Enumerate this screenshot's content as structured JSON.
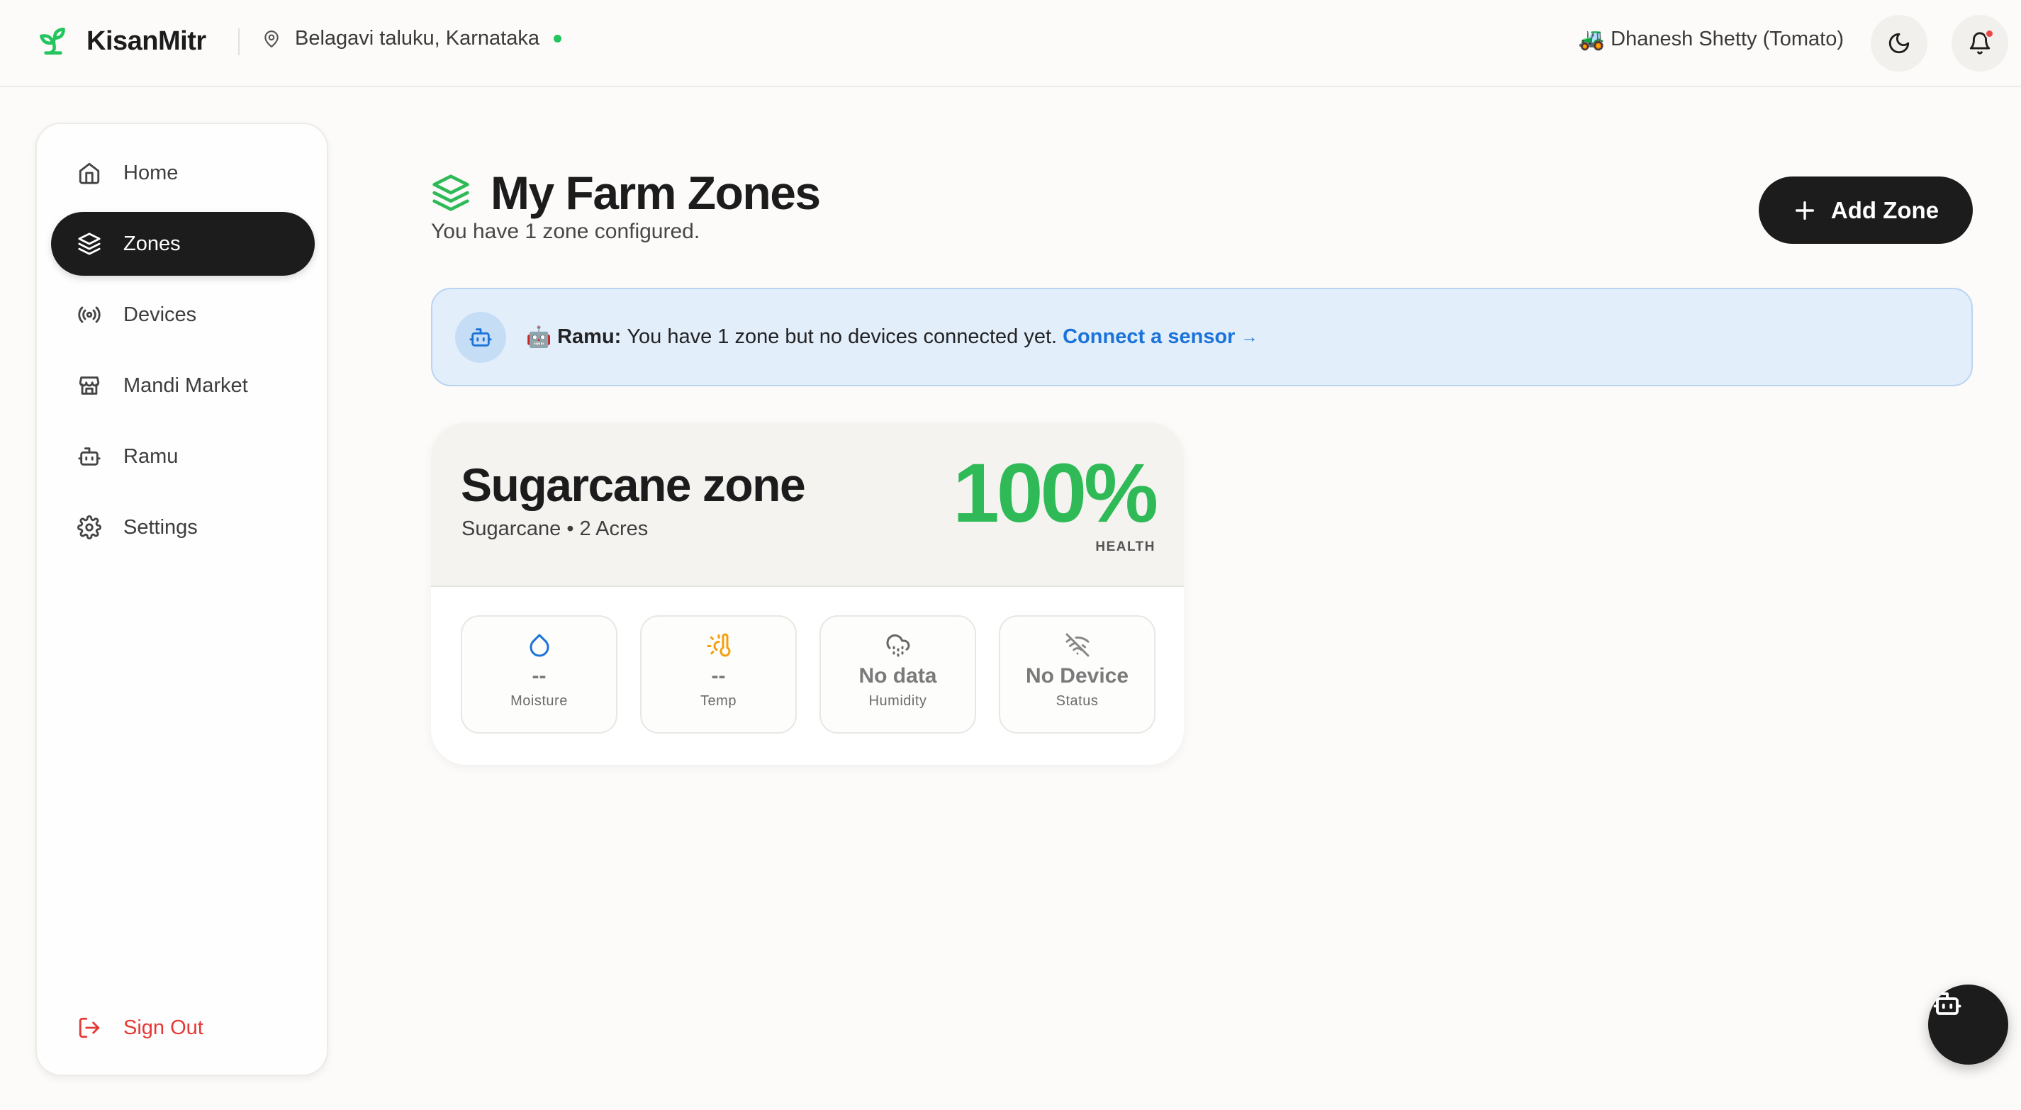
{
  "header": {
    "brand": "KisanMitr",
    "location": "Belagavi taluku, Karnataka",
    "user_emoji": "🚜",
    "user": "Dhanesh Shetty (Tomato)",
    "accent": "#22c55e"
  },
  "sidebar": {
    "items": [
      {
        "label": "Home",
        "icon": "home-icon"
      },
      {
        "label": "Zones",
        "icon": "layers-icon",
        "active": true
      },
      {
        "label": "Devices",
        "icon": "broadcast-icon"
      },
      {
        "label": "Mandi Market",
        "icon": "store-icon"
      },
      {
        "label": "Ramu",
        "icon": "bot-icon"
      },
      {
        "label": "Settings",
        "icon": "gear-icon"
      }
    ],
    "sign_out": "Sign Out"
  },
  "main": {
    "title": "My Farm Zones",
    "subtitle": "You have 1 zone configured.",
    "add_button": "Add Zone"
  },
  "banner": {
    "emoji": "🤖",
    "name": "Ramu:",
    "message": "You have 1 zone but no devices connected yet.",
    "link": "Connect a sensor",
    "arrow": "→"
  },
  "zone": {
    "name": "Sugarcane zone",
    "meta": "Sugarcane • 2 Acres",
    "health": "100%",
    "health_label": "HEALTH",
    "metrics": [
      {
        "value": "--",
        "label": "Moisture",
        "icon": "droplet-icon"
      },
      {
        "value": "--",
        "label": "Temp",
        "icon": "thermometer-sun-icon"
      },
      {
        "value": "No data",
        "label": "Humidity",
        "icon": "cloud-drizzle-icon"
      },
      {
        "value": "No Device",
        "label": "Status",
        "icon": "wifi-off-icon"
      }
    ]
  },
  "colors": {
    "health_green": "#2fba57",
    "link_blue": "#1a73d9",
    "sign_out_red": "#e53935",
    "notification_red": "#ef4444"
  }
}
